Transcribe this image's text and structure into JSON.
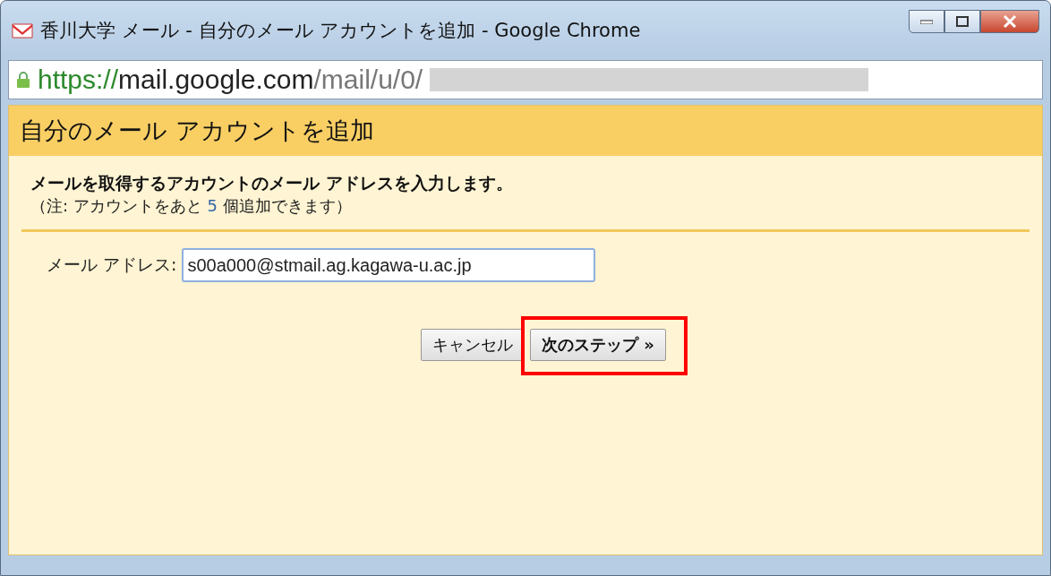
{
  "window": {
    "title": "香川大学 メール - 自分のメール アカウントを追加 - Google Chrome"
  },
  "address_bar": {
    "scheme": "https://",
    "host": "mail.google.com",
    "path": "/mail/u/0/"
  },
  "dialog": {
    "title": "自分のメール アカウントを追加",
    "instruction": "メールを取得するアカウントのメール アドレスを入力します。",
    "note_prefix": "（注: アカウントをあと ",
    "note_count": "5",
    "note_suffix": " 個追加できます）",
    "field": {
      "label": "メール アドレス:",
      "value": "s00a000@stmail.ag.kagawa-u.ac.jp"
    },
    "buttons": [
      {
        "label": "キャンセル",
        "kind": "normal",
        "highlighted": false
      },
      {
        "label": "次のステップ »",
        "kind": "primary",
        "highlighted": true
      }
    ]
  }
}
